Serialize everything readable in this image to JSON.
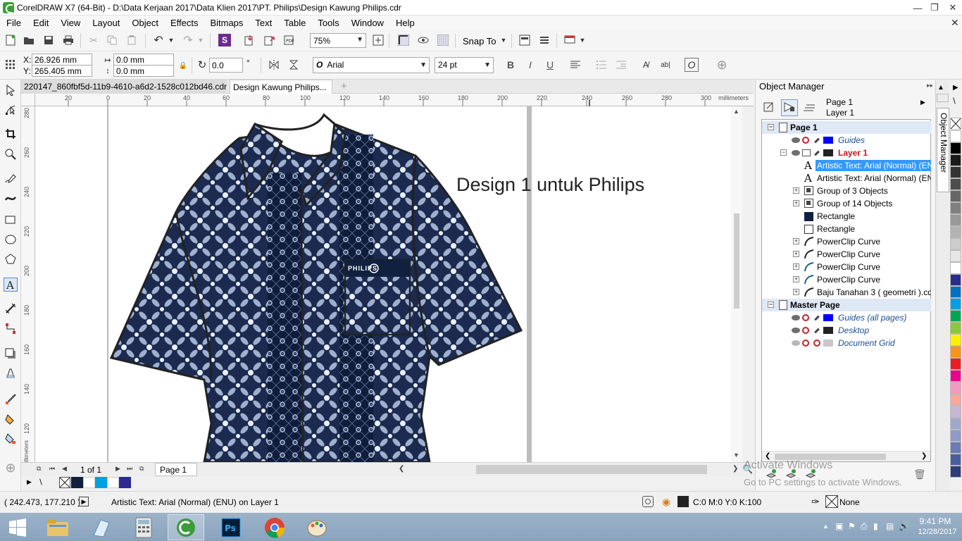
{
  "window": {
    "title": "CorelDRAW X7 (64-Bit) - D:\\Data Kerjaan 2017\\Data Klien 2017\\PT. Philips\\Design Kawung Philips.cdr"
  },
  "menu": [
    "File",
    "Edit",
    "View",
    "Layout",
    "Object",
    "Effects",
    "Bitmaps",
    "Text",
    "Table",
    "Tools",
    "Window",
    "Help"
  ],
  "toolbar": {
    "zoom": "75%",
    "snap_to": "Snap To"
  },
  "property_bar": {
    "x_label": "X:",
    "x_value": "26.926 mm",
    "y_label": "Y:",
    "y_value": "265.405 mm",
    "w_value": "0.0 mm",
    "h_value": "0.0 mm",
    "rotation": "0.0",
    "degree": "°",
    "font_name": "Arial",
    "font_size": "24 pt"
  },
  "doc_tabs": [
    "220147_860fbf5d-11b9-4610-a6d2-1528c012bd46.cdr",
    "Design Kawung Philips..."
  ],
  "ruler": {
    "h_labels": [
      "20",
      "0",
      "20",
      "40",
      "60",
      "80",
      "100",
      "120",
      "140",
      "160",
      "180",
      "200",
      "220",
      "240",
      "260",
      "280",
      "300"
    ],
    "h_unit": "millimeters",
    "v_labels": [
      "280",
      "260",
      "240",
      "220",
      "200",
      "180",
      "160",
      "140",
      "120"
    ],
    "v_unit": "millimeters"
  },
  "canvas": {
    "design_text": "Design 1 untuk Philips",
    "pocket_label": "PHILIPS"
  },
  "page_nav": {
    "page_count": "1 of 1",
    "page_tab": "Page 1"
  },
  "status": {
    "coords": "( 242.473, 177.210 )",
    "selection": "Artistic Text: Arial (Normal) (ENU) on Layer 1",
    "fill": "C:0 M:0 Y:0 K:100",
    "outline": "None"
  },
  "object_manager": {
    "title": "Object Manager",
    "current_page": "Page 1",
    "current_layer": "Layer 1",
    "page_header": "Page 1",
    "guides": "Guides",
    "layer": "Layer 1",
    "items": [
      "Artistic Text: Arial (Normal) (EN",
      "Artistic Text: Arial (Normal) (EN",
      "Group of 3 Objects",
      "Group of 14 Objects",
      "Rectangle",
      "Rectangle",
      "PowerClip Curve",
      "PowerClip Curve",
      "PowerClip Curve",
      "PowerClip Curve",
      "Baju Tanahan 3 ( geometri ).cd"
    ],
    "master_header": "Master Page",
    "master_items": [
      "Guides (all pages)",
      "Desktop",
      "Document Grid"
    ],
    "side_tab": "Object Manager"
  },
  "activation": {
    "line1": "Activate Windows",
    "line2": "Go to PC settings to activate Windows."
  },
  "clock": {
    "time": "9:41 PM",
    "date": "12/28/2017"
  },
  "colors": {
    "navy": "#10203f",
    "accent": "#3399ff",
    "layer_red": "#d0121a"
  },
  "palette_colors": [
    "#ffffff",
    "#000000",
    "#1a1a1a",
    "#333333",
    "#4d4d4d",
    "#666666",
    "#808080",
    "#999999",
    "#b3b3b3",
    "#cccccc",
    "#e6e6e6",
    "#ffffff",
    "#2b2b8f",
    "#0070c0",
    "#00a0e3",
    "#00a651",
    "#8dc63f",
    "#fff200",
    "#f7941d",
    "#ed1c24",
    "#ec008c",
    "#f49ac1",
    "#f9a99c",
    "#c8b6d8",
    "#9fa9d0",
    "#8f9bc8",
    "#6b7bb5",
    "#4a5d9e",
    "#2d3c7a"
  ]
}
